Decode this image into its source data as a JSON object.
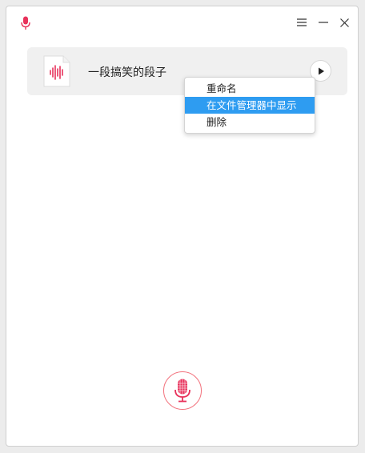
{
  "window": {
    "title": ""
  },
  "titlebar": {
    "app_icon": "microphone-icon",
    "menu_icon": "hamburger-menu-icon",
    "minimize_icon": "minimize-icon",
    "close_icon": "close-icon"
  },
  "record_item": {
    "title": "一段搞笑的段子",
    "file_icon": "audio-file-icon",
    "play_icon": "play-icon"
  },
  "context_menu": {
    "items": [
      {
        "label": "重命名"
      },
      {
        "label": "在文件管理器中显示"
      },
      {
        "label": "删除"
      }
    ],
    "active_index": 1
  },
  "record_button": {
    "icon": "microphone-icon"
  },
  "colors": {
    "accent": "#e8325b",
    "highlight": "#2e9cf1",
    "record_border": "#f2717c"
  }
}
